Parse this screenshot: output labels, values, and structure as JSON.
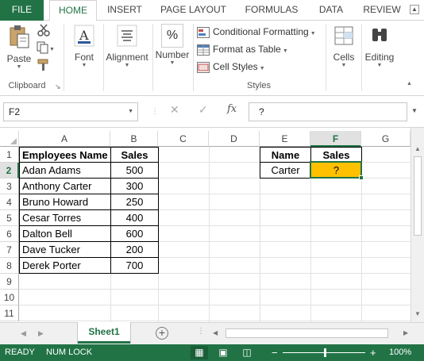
{
  "tabs": {
    "file": "FILE",
    "home": "HOME",
    "insert": "INSERT",
    "page_layout": "PAGE LAYOUT",
    "formulas": "FORMULAS",
    "data": "DATA",
    "review": "REVIEW"
  },
  "ribbon": {
    "clipboard": {
      "paste": "Paste",
      "group_label": "Clipboard"
    },
    "font": {
      "label": "Font"
    },
    "alignment": {
      "label": "Alignment"
    },
    "number": {
      "label": "Number",
      "icon_glyph": "%"
    },
    "styles": {
      "conditional_formatting": "Conditional Formatting",
      "format_as_table": "Format as Table",
      "cell_styles": "Cell Styles",
      "group_label": "Styles"
    },
    "cells": {
      "label": "Cells"
    },
    "editing": {
      "label": "Editing"
    }
  },
  "formula_bar": {
    "name_box": "F2",
    "formula": "?",
    "fx_label": "fx"
  },
  "columns": [
    "A",
    "B",
    "C",
    "D",
    "E",
    "F",
    "G"
  ],
  "rows": [
    "1",
    "2",
    "3",
    "4",
    "5",
    "6",
    "7",
    "8",
    "9",
    "10",
    "11"
  ],
  "table_left": {
    "headers": [
      "Employees Name",
      "Sales"
    ],
    "rows": [
      [
        "Adan Adams",
        "500"
      ],
      [
        "Anthony Carter",
        "300"
      ],
      [
        "Bruno Howard",
        "250"
      ],
      [
        "Cesar Torres",
        "400"
      ],
      [
        "Dalton Bell",
        "600"
      ],
      [
        "Dave Tucker",
        "200"
      ],
      [
        "Derek Porter",
        "700"
      ]
    ]
  },
  "table_lookup": {
    "headers": [
      "Name",
      "Sales"
    ],
    "name": "Carter",
    "result": "?"
  },
  "active_cell": "F2",
  "highlight_color": "#ffc000",
  "accent_color": "#217346",
  "sheet_tabs": [
    "Sheet1"
  ],
  "status": {
    "ready": "READY",
    "num_lock": "NUM LOCK",
    "zoom": "100%",
    "zoom_level": 100
  }
}
